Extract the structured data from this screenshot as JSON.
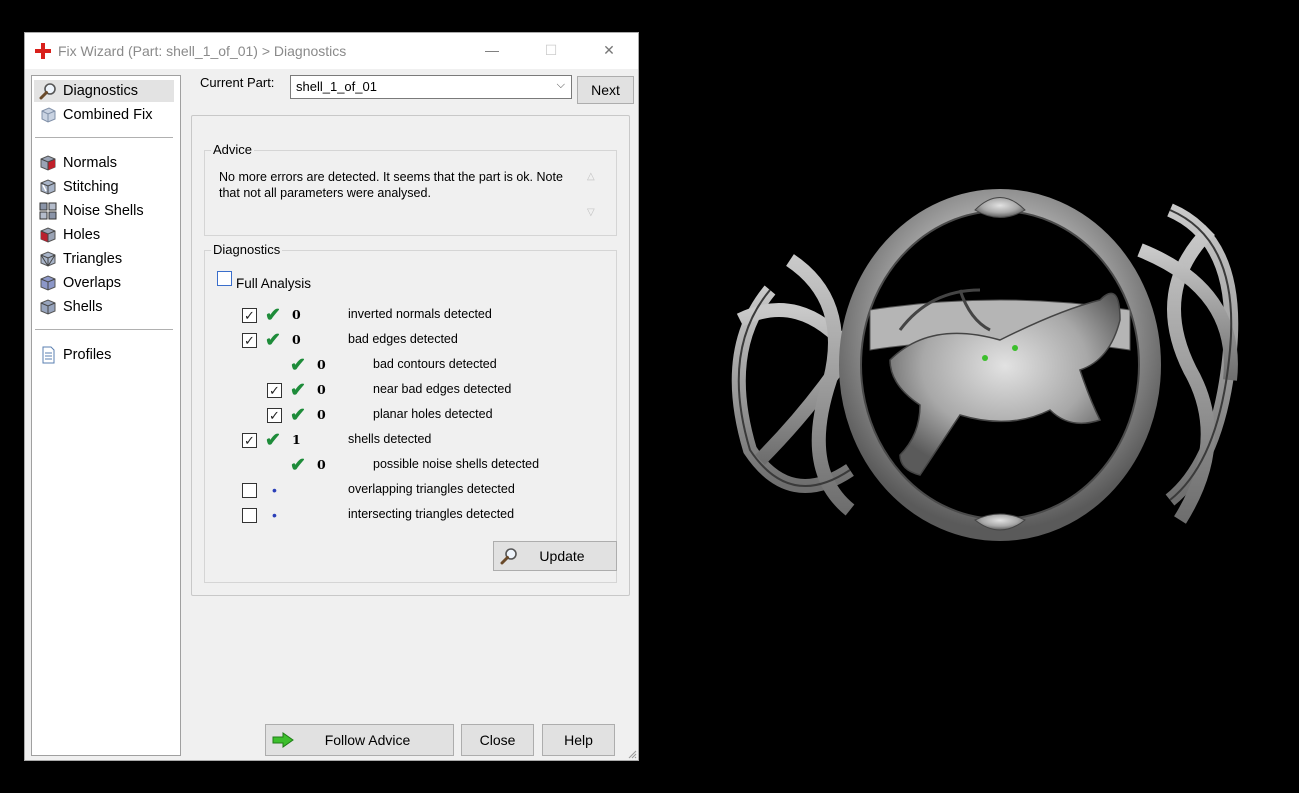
{
  "window": {
    "title": "Fix Wizard (Part: shell_1_of_01) > Diagnostics",
    "minimize": "—",
    "maximize": "☐",
    "close": "✕"
  },
  "nav": {
    "items": [
      {
        "label": "Diagnostics",
        "icon": "magnifier-icon"
      },
      {
        "label": "Combined Fix",
        "icon": "combined-fix-cube-icon"
      },
      {
        "label": "Normals",
        "icon": "normals-cube-icon"
      },
      {
        "label": "Stitching",
        "icon": "stitching-cube-icon"
      },
      {
        "label": "Noise Shells",
        "icon": "noise-shells-cube-icon"
      },
      {
        "label": "Holes",
        "icon": "holes-cube-icon"
      },
      {
        "label": "Triangles",
        "icon": "triangles-cube-icon"
      },
      {
        "label": "Overlaps",
        "icon": "overlaps-cube-icon"
      },
      {
        "label": "Shells",
        "icon": "shells-cube-icon"
      },
      {
        "label": "Profiles",
        "icon": "profiles-document-icon"
      }
    ]
  },
  "current_part": {
    "label": "Current Part:",
    "value": "shell_1_of_01",
    "next_label": "Next"
  },
  "advice": {
    "title": "Advice",
    "text": "No more errors are detected. It seems that the part is ok. Note that not all parameters were analysed."
  },
  "diagnostics": {
    "title": "Diagnostics",
    "full_analysis_label": "Full Analysis",
    "full_analysis_checked": false,
    "rows": [
      {
        "checkbox": true,
        "checked": true,
        "status": "ok",
        "count": "0",
        "label": "inverted normals detected"
      },
      {
        "checkbox": true,
        "checked": true,
        "status": "ok",
        "count": "0",
        "label": "bad edges detected"
      },
      {
        "checkbox": false,
        "checked": false,
        "status": "ok",
        "count": "0",
        "label": "bad contours detected"
      },
      {
        "checkbox": true,
        "checked": true,
        "status": "ok",
        "count": "0",
        "label": "near bad edges detected"
      },
      {
        "checkbox": true,
        "checked": true,
        "status": "ok",
        "count": "0",
        "label": "planar holes detected"
      },
      {
        "checkbox": true,
        "checked": true,
        "status": "ok",
        "count": "1",
        "label": "shells detected"
      },
      {
        "checkbox": false,
        "checked": false,
        "status": "ok",
        "count": "0",
        "label": "possible noise shells detected"
      },
      {
        "checkbox": true,
        "checked": false,
        "status": "not-analysed",
        "count": "",
        "label": "overlapping triangles detected"
      },
      {
        "checkbox": true,
        "checked": false,
        "status": "not-analysed",
        "count": "",
        "label": "intersecting triangles detected"
      }
    ],
    "update_label": "Update"
  },
  "footer": {
    "follow_advice_label": "Follow Advice",
    "close_label": "Close",
    "help_label": "Help"
  },
  "colors": {
    "ok_tick": "#1e8c3a",
    "not_analysed_dot": "#2a3fb8",
    "title_icon": "#d9201b",
    "follow_arrow": "#3cbf2c"
  }
}
